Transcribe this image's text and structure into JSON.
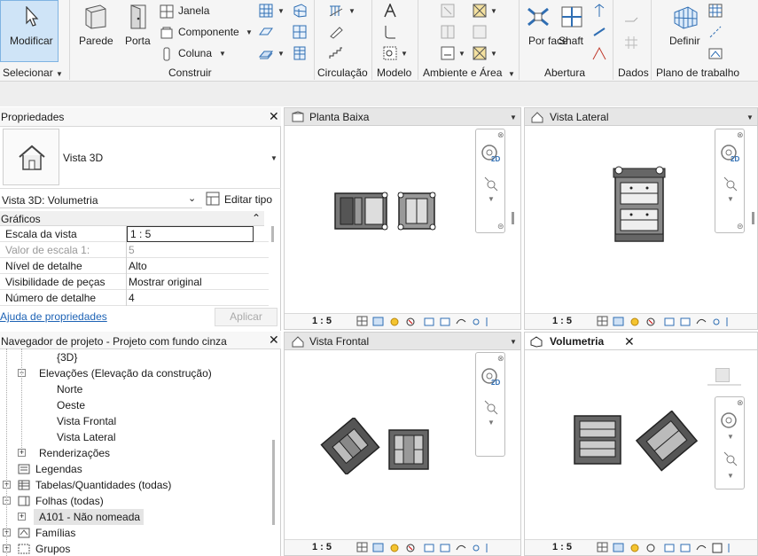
{
  "ribbon": {
    "modify": "Modificar",
    "select_group": "Selecionar",
    "wall": "Parede",
    "door": "Porta",
    "window": "Janela",
    "component": "Componente",
    "column": "Coluna",
    "build_group": "Construir",
    "circulation_group": "Circulação",
    "model_group": "Modelo",
    "room_group": "Ambiente e Área",
    "by_face": "Por face",
    "shaft": "Shaft",
    "opening_group": "Abertura",
    "datum_group": "Dados",
    "define": "Definir",
    "workplane_group": "Plano de trabalho"
  },
  "properties": {
    "title": "Propriedades",
    "type_name": "Vista 3D",
    "instance_select": "Vista 3D: Volumetria",
    "edit_type": "Editar tipo",
    "section": "Gráficos",
    "rows": [
      {
        "label": "Escala da vista",
        "value": "1 : 5"
      },
      {
        "label": "Valor de escala    1:",
        "value": "5"
      },
      {
        "label": "Nível de detalhe",
        "value": "Alto"
      },
      {
        "label": "Visibilidade de peças",
        "value": "Mostrar original"
      },
      {
        "label": "Número de detalhe",
        "value": "4"
      }
    ],
    "help": "Ajuda de propriedades",
    "apply": "Aplicar"
  },
  "browser": {
    "title": "Navegador de projeto - Projeto com fundo cinza",
    "items": [
      {
        "label": "{3D}"
      },
      {
        "label": "Elevações (Elevação da construção)"
      },
      {
        "label": "Norte"
      },
      {
        "label": "Oeste"
      },
      {
        "label": "Vista Frontal"
      },
      {
        "label": "Vista Lateral"
      },
      {
        "label": "Renderizações"
      },
      {
        "label": "Legendas"
      },
      {
        "label": "Tabelas/Quantidades (todas)"
      },
      {
        "label": "Folhas (todas)"
      },
      {
        "label": "A101 - Não nomeada"
      },
      {
        "label": "Famílias"
      },
      {
        "label": "Grupos"
      }
    ]
  },
  "views": {
    "plan": {
      "title": "Planta Baixa",
      "scale": "1 : 5"
    },
    "side": {
      "title": "Vista Lateral",
      "scale": "1 : 5"
    },
    "front": {
      "title": "Vista Frontal",
      "scale": "1 : 5"
    },
    "volume": {
      "title": "Volumetria",
      "scale": "1 : 5"
    }
  },
  "nav": {
    "label_2d": "2D"
  },
  "colors": {
    "accent": "#cfe4f7",
    "accent_border": "#7fb3e2",
    "link": "#1e63b5"
  }
}
